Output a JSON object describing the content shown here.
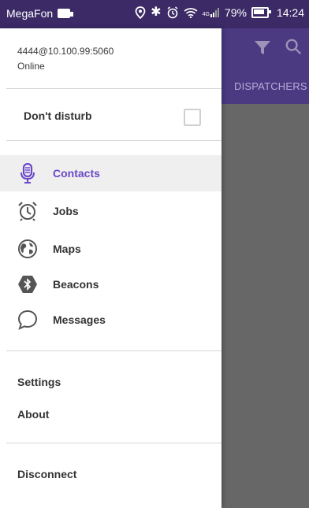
{
  "status_bar": {
    "carrier": "MegaFon",
    "signal_label": "4G",
    "battery_percent": "79%",
    "time": "14:24"
  },
  "background_app": {
    "tab_label": "DISPATCHERS"
  },
  "drawer": {
    "account": "4444@10.100.99:5060",
    "status": "Online",
    "dont_disturb_label": "Don't disturb",
    "dont_disturb_checked": false,
    "items": [
      {
        "label": "Contacts",
        "icon": "microphone-icon",
        "active": true
      },
      {
        "label": "Jobs",
        "icon": "alarm-clock-icon",
        "active": false
      },
      {
        "label": "Maps",
        "icon": "globe-icon",
        "active": false
      },
      {
        "label": "Beacons",
        "icon": "bluetooth-icon",
        "active": false
      },
      {
        "label": "Messages",
        "icon": "chat-bubble-icon",
        "active": false
      }
    ],
    "settings_label": "Settings",
    "about_label": "About",
    "disconnect_label": "Disconnect"
  },
  "colors": {
    "status_bar_bg": "#3b2a66",
    "app_bar_bg": "#4b3a82",
    "accent": "#6b48c8",
    "scrim": "#676767"
  }
}
